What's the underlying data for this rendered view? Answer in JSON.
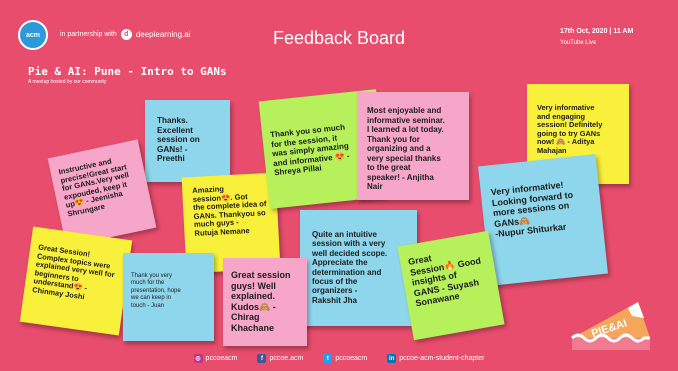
{
  "header": {
    "logo_text": "acm",
    "partner_prefix": "in partnership with",
    "partner_name": "deeplearning.ai",
    "title": "Feedback Board",
    "date": "17th Oct, 2020 | 11 AM",
    "platform": "YouTube Live"
  },
  "event": {
    "title": "Pie & AI: Pune - Intro to GANs",
    "subtitle": "A meetup hosted by our community"
  },
  "notes": [
    {
      "id": "n1",
      "lines": [
        "Thanks.",
        "Excellent",
        "session on",
        "GANs! -",
        "Preethi"
      ]
    },
    {
      "id": "n2",
      "lines": [
        "Instructive and",
        "precise!Great start",
        "for GANs.Very well",
        "expouded, keep it",
        "up😍 - Jeenisha",
        "Shrungare"
      ]
    },
    {
      "id": "n3",
      "lines": [
        "Amazing",
        "session😍. Got",
        "the complete idea of",
        "GANs. Thankyou so",
        "much guys -",
        "Rutuja Nemane"
      ]
    },
    {
      "id": "n4",
      "lines": [
        "Thank you so much",
        "for the session, it",
        "was simply amazing",
        "and informative 😍 -",
        "Shreya Pillai"
      ]
    },
    {
      "id": "n5",
      "lines": [
        "Most enjoyable and",
        "informative seminar.",
        "I learned a lot today.",
        "Thank you for",
        "organizing and a",
        "very special thanks",
        "to the great",
        "speaker! - Anjitha",
        "Nair"
      ]
    },
    {
      "id": "n6",
      "lines": [
        "Very informative",
        "and engaging",
        "session! Definitely",
        "going to try GANs",
        "now! 🙈 - Aditya",
        "Mahajan"
      ]
    },
    {
      "id": "n7",
      "lines": [
        "Very informative!",
        "Looking forward to",
        "more sessions on",
        "GANs🙈",
        "-Nupur Shiturkar"
      ]
    },
    {
      "id": "n8",
      "lines": [
        "Quite an intuitive",
        "session with a very",
        "well decided scope.",
        "Appreciate the",
        "determination and",
        "focus of the",
        "organizers    -",
        "Rakshit Jha"
      ]
    },
    {
      "id": "n9",
      "lines": [
        "Great Session!",
        "Complex topics were",
        "explained very well for",
        "beginners to",
        "understand😍 -",
        "Chinmay Joshi"
      ]
    },
    {
      "id": "n10",
      "lines": [
        "Thank you very",
        "much for the",
        "presentation, hope",
        "we can keep in",
        "touch - Juan"
      ]
    },
    {
      "id": "n11",
      "lines": [
        "Great session",
        "guys! Well",
        "explained.",
        "Kudos🙈 -",
        "Chirag",
        "Khachane"
      ]
    },
    {
      "id": "n12",
      "lines": [
        "Great",
        "Session🔥 Good",
        "insights of",
        "GANS - Suyash",
        "Sonawane"
      ]
    }
  ],
  "pie_label": "PIE&AI",
  "social": [
    {
      "icon": "instagram-icon",
      "color": "#c13584",
      "label": "pccoeacm"
    },
    {
      "icon": "facebook-icon",
      "color": "#3b5998",
      "label": "pccoe.acm"
    },
    {
      "icon": "twitter-icon",
      "color": "#1da1f2",
      "label": "pccoeacm"
    },
    {
      "icon": "linkedin-icon",
      "color": "#0077b5",
      "label": "pccoe-acm-student-chapter"
    }
  ]
}
